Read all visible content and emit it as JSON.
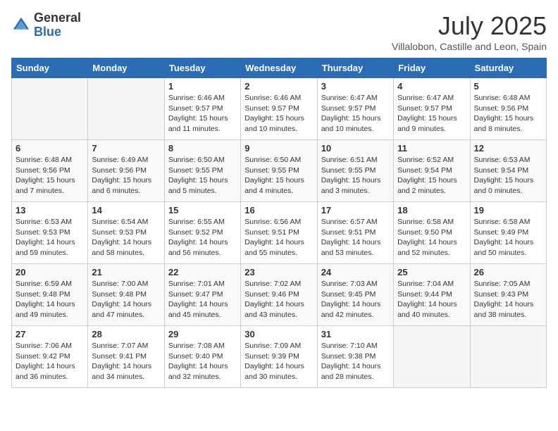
{
  "header": {
    "logo_general": "General",
    "logo_blue": "Blue",
    "month_title": "July 2025",
    "subtitle": "Villalobon, Castille and Leon, Spain"
  },
  "weekdays": [
    "Sunday",
    "Monday",
    "Tuesday",
    "Wednesday",
    "Thursday",
    "Friday",
    "Saturday"
  ],
  "weeks": [
    [
      {
        "day": "",
        "info": ""
      },
      {
        "day": "",
        "info": ""
      },
      {
        "day": "1",
        "info": "Sunrise: 6:46 AM\nSunset: 9:57 PM\nDaylight: 15 hours and 11 minutes."
      },
      {
        "day": "2",
        "info": "Sunrise: 6:46 AM\nSunset: 9:57 PM\nDaylight: 15 hours and 10 minutes."
      },
      {
        "day": "3",
        "info": "Sunrise: 6:47 AM\nSunset: 9:57 PM\nDaylight: 15 hours and 10 minutes."
      },
      {
        "day": "4",
        "info": "Sunrise: 6:47 AM\nSunset: 9:57 PM\nDaylight: 15 hours and 9 minutes."
      },
      {
        "day": "5",
        "info": "Sunrise: 6:48 AM\nSunset: 9:56 PM\nDaylight: 15 hours and 8 minutes."
      }
    ],
    [
      {
        "day": "6",
        "info": "Sunrise: 6:48 AM\nSunset: 9:56 PM\nDaylight: 15 hours and 7 minutes."
      },
      {
        "day": "7",
        "info": "Sunrise: 6:49 AM\nSunset: 9:56 PM\nDaylight: 15 hours and 6 minutes."
      },
      {
        "day": "8",
        "info": "Sunrise: 6:50 AM\nSunset: 9:55 PM\nDaylight: 15 hours and 5 minutes."
      },
      {
        "day": "9",
        "info": "Sunrise: 6:50 AM\nSunset: 9:55 PM\nDaylight: 15 hours and 4 minutes."
      },
      {
        "day": "10",
        "info": "Sunrise: 6:51 AM\nSunset: 9:55 PM\nDaylight: 15 hours and 3 minutes."
      },
      {
        "day": "11",
        "info": "Sunrise: 6:52 AM\nSunset: 9:54 PM\nDaylight: 15 hours and 2 minutes."
      },
      {
        "day": "12",
        "info": "Sunrise: 6:53 AM\nSunset: 9:54 PM\nDaylight: 15 hours and 0 minutes."
      }
    ],
    [
      {
        "day": "13",
        "info": "Sunrise: 6:53 AM\nSunset: 9:53 PM\nDaylight: 14 hours and 59 minutes."
      },
      {
        "day": "14",
        "info": "Sunrise: 6:54 AM\nSunset: 9:53 PM\nDaylight: 14 hours and 58 minutes."
      },
      {
        "day": "15",
        "info": "Sunrise: 6:55 AM\nSunset: 9:52 PM\nDaylight: 14 hours and 56 minutes."
      },
      {
        "day": "16",
        "info": "Sunrise: 6:56 AM\nSunset: 9:51 PM\nDaylight: 14 hours and 55 minutes."
      },
      {
        "day": "17",
        "info": "Sunrise: 6:57 AM\nSunset: 9:51 PM\nDaylight: 14 hours and 53 minutes."
      },
      {
        "day": "18",
        "info": "Sunrise: 6:58 AM\nSunset: 9:50 PM\nDaylight: 14 hours and 52 minutes."
      },
      {
        "day": "19",
        "info": "Sunrise: 6:58 AM\nSunset: 9:49 PM\nDaylight: 14 hours and 50 minutes."
      }
    ],
    [
      {
        "day": "20",
        "info": "Sunrise: 6:59 AM\nSunset: 9:48 PM\nDaylight: 14 hours and 49 minutes."
      },
      {
        "day": "21",
        "info": "Sunrise: 7:00 AM\nSunset: 9:48 PM\nDaylight: 14 hours and 47 minutes."
      },
      {
        "day": "22",
        "info": "Sunrise: 7:01 AM\nSunset: 9:47 PM\nDaylight: 14 hours and 45 minutes."
      },
      {
        "day": "23",
        "info": "Sunrise: 7:02 AM\nSunset: 9:46 PM\nDaylight: 14 hours and 43 minutes."
      },
      {
        "day": "24",
        "info": "Sunrise: 7:03 AM\nSunset: 9:45 PM\nDaylight: 14 hours and 42 minutes."
      },
      {
        "day": "25",
        "info": "Sunrise: 7:04 AM\nSunset: 9:44 PM\nDaylight: 14 hours and 40 minutes."
      },
      {
        "day": "26",
        "info": "Sunrise: 7:05 AM\nSunset: 9:43 PM\nDaylight: 14 hours and 38 minutes."
      }
    ],
    [
      {
        "day": "27",
        "info": "Sunrise: 7:06 AM\nSunset: 9:42 PM\nDaylight: 14 hours and 36 minutes."
      },
      {
        "day": "28",
        "info": "Sunrise: 7:07 AM\nSunset: 9:41 PM\nDaylight: 14 hours and 34 minutes."
      },
      {
        "day": "29",
        "info": "Sunrise: 7:08 AM\nSunset: 9:40 PM\nDaylight: 14 hours and 32 minutes."
      },
      {
        "day": "30",
        "info": "Sunrise: 7:09 AM\nSunset: 9:39 PM\nDaylight: 14 hours and 30 minutes."
      },
      {
        "day": "31",
        "info": "Sunrise: 7:10 AM\nSunset: 9:38 PM\nDaylight: 14 hours and 28 minutes."
      },
      {
        "day": "",
        "info": ""
      },
      {
        "day": "",
        "info": ""
      }
    ]
  ]
}
